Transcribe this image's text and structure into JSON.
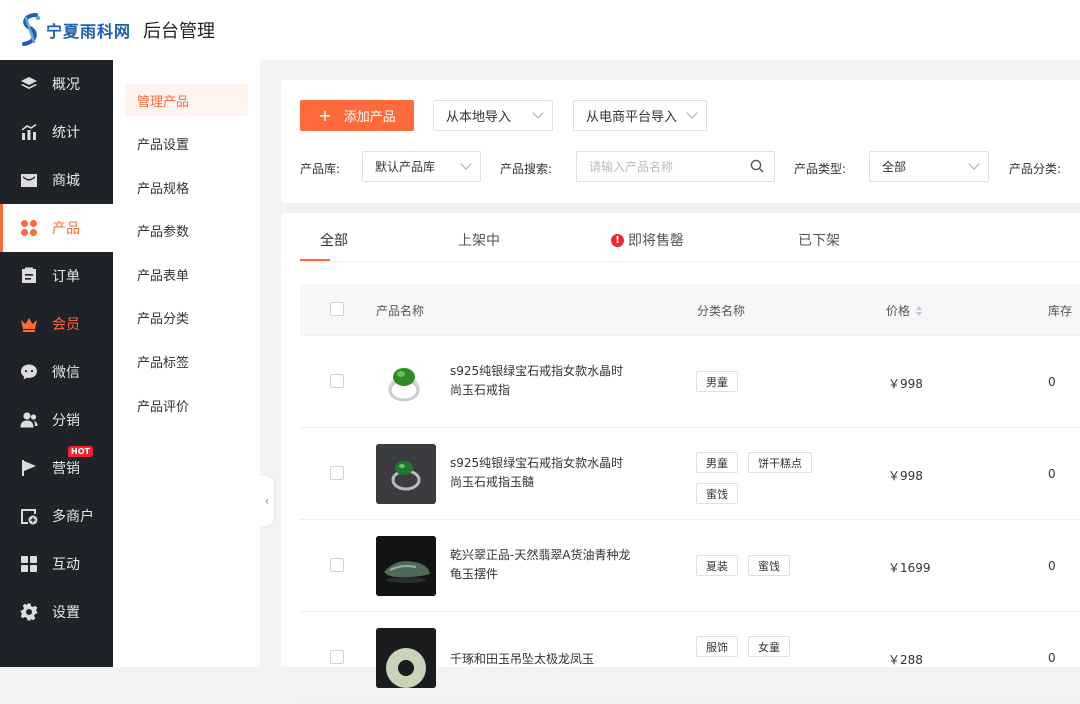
{
  "header": {
    "logo_text": "宁夏雨科网",
    "title": "后台管理"
  },
  "nav": {
    "items": [
      {
        "label": "概况",
        "icon": "layers-icon"
      },
      {
        "label": "统计",
        "icon": "chart-icon"
      },
      {
        "label": "商城",
        "icon": "shop-icon"
      },
      {
        "label": "产品",
        "icon": "grid-icon"
      },
      {
        "label": "订单",
        "icon": "order-icon"
      },
      {
        "label": "会员",
        "icon": "crown-icon"
      },
      {
        "label": "微信",
        "icon": "wechat-icon"
      },
      {
        "label": "分销",
        "icon": "users-icon"
      },
      {
        "label": "营销",
        "icon": "flag-icon",
        "badge": "HOT"
      },
      {
        "label": "多商户",
        "icon": "store-plus-icon"
      },
      {
        "label": "互动",
        "icon": "apps-icon"
      },
      {
        "label": "设置",
        "icon": "gear-icon"
      }
    ]
  },
  "subnav": {
    "items": [
      "管理产品",
      "产品设置",
      "产品规格",
      "产品参数",
      "产品表单",
      "产品分类",
      "产品标签",
      "产品评价"
    ]
  },
  "toolbar": {
    "add_label": "添加产品",
    "import_local": "从本地导入",
    "import_ecom": "从电商平台导入",
    "lib_label": "产品库:",
    "lib_value": "默认产品库",
    "search_label": "产品搜索:",
    "search_placeholder": "请输入产品名称",
    "type_label": "产品类型:",
    "type_value": "全部",
    "category_label": "产品分类:"
  },
  "tabs": [
    "全部",
    "上架中",
    "即将售罄",
    "已下架"
  ],
  "table": {
    "headers": {
      "name": "产品名称",
      "category": "分类名称",
      "price": "价格",
      "stock": "库存"
    },
    "rows": [
      {
        "name": "s925纯银绿宝石戒指女款水晶时尚玉石戒指",
        "tags": [
          "男童"
        ],
        "price": "￥998",
        "stock": "0"
      },
      {
        "name": "s925纯银绿宝石戒指女款水晶时尚玉石戒指玉髓",
        "tags": [
          "男童",
          "饼干糕点",
          "蜜饯"
        ],
        "price": "￥998",
        "stock": "0"
      },
      {
        "name": "乾兴翠正品-天然翡翠A货油青种龙龟玉摆件",
        "tags": [
          "夏装",
          "蜜饯"
        ],
        "price": "￥1699",
        "stock": "0"
      },
      {
        "name": "千琢和田玉吊坠太极龙凤玉",
        "tags": [
          "服饰",
          "女童"
        ],
        "price": "￥288",
        "stock": "0"
      }
    ]
  },
  "colors": {
    "accent": "#ff6a3d",
    "nav_bg": "#1f2329"
  }
}
